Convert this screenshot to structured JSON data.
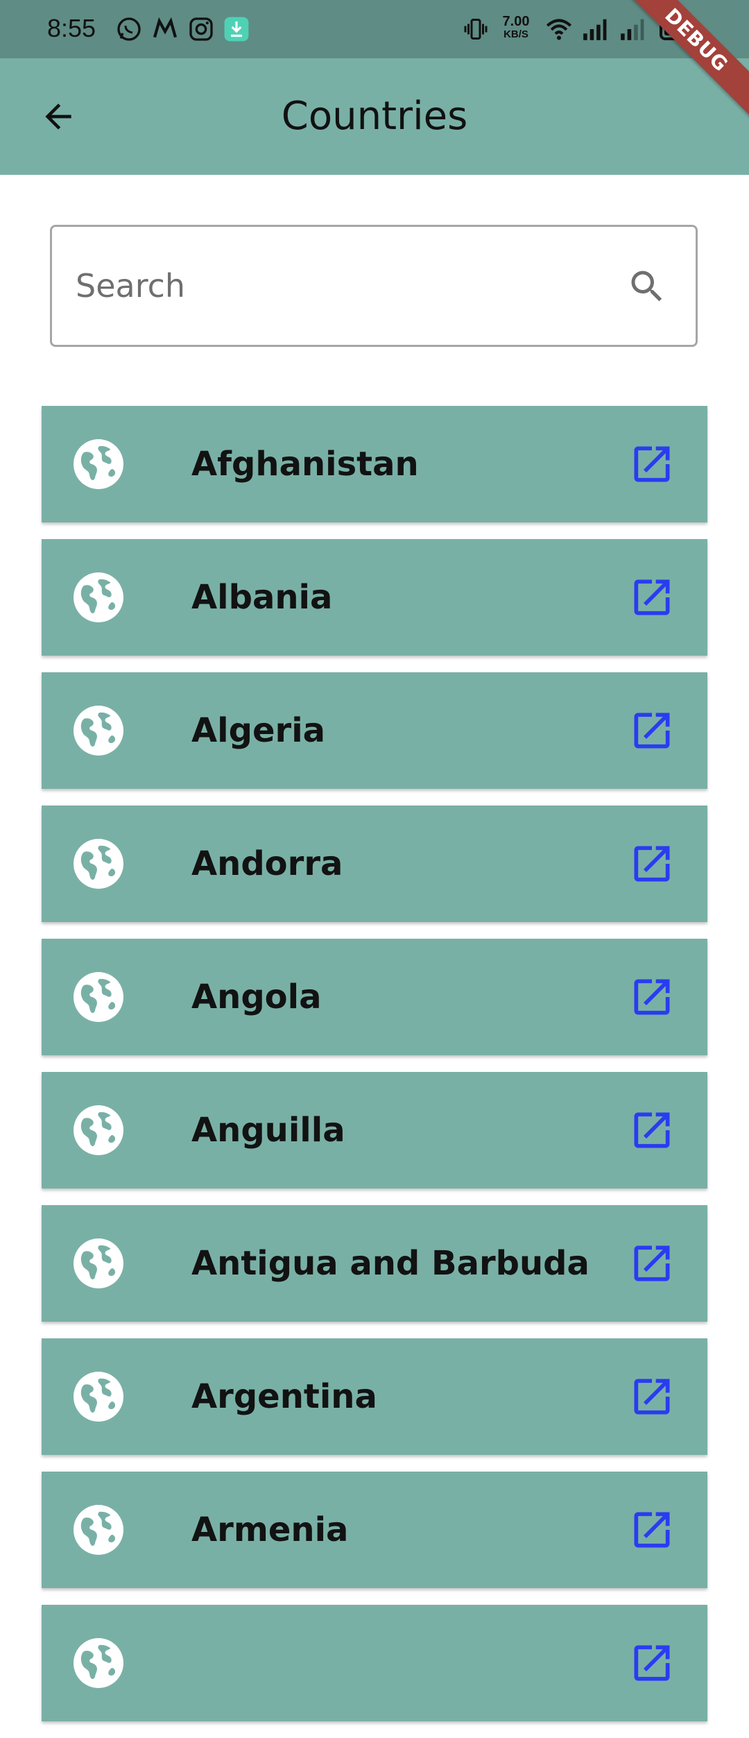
{
  "status_bar": {
    "time": "8:55",
    "net_speed_value": "7.00",
    "net_speed_unit": "KB/S",
    "notification_icons": [
      "whatsapp-icon",
      "myntra-icon",
      "instagram-icon",
      "download-icon"
    ],
    "system_icons": [
      "vibrate-icon",
      "wifi-icon",
      "signal-icon",
      "signal-icon",
      "battery-icon"
    ]
  },
  "app_bar": {
    "title": "Countries",
    "back_icon": "arrow-back-icon",
    "debug_banner": "DEBUG"
  },
  "search": {
    "placeholder": "Search",
    "value": "",
    "icon": "search-icon"
  },
  "countries": [
    "Afghanistan",
    "Albania",
    "Algeria",
    "Andorra",
    "Angola",
    "Anguilla",
    "Antigua and Barbuda",
    "Argentina",
    "Armenia",
    ""
  ],
  "item_icons": {
    "leading": "globe-icon",
    "trailing": "open-in-new-icon"
  },
  "colors": {
    "status_bar": "#5f8c85",
    "app_bar": "#79b0a6",
    "card": "#79b0a6",
    "open_icon": "#2a3cf0",
    "debug_ribbon": "#a3413b"
  }
}
